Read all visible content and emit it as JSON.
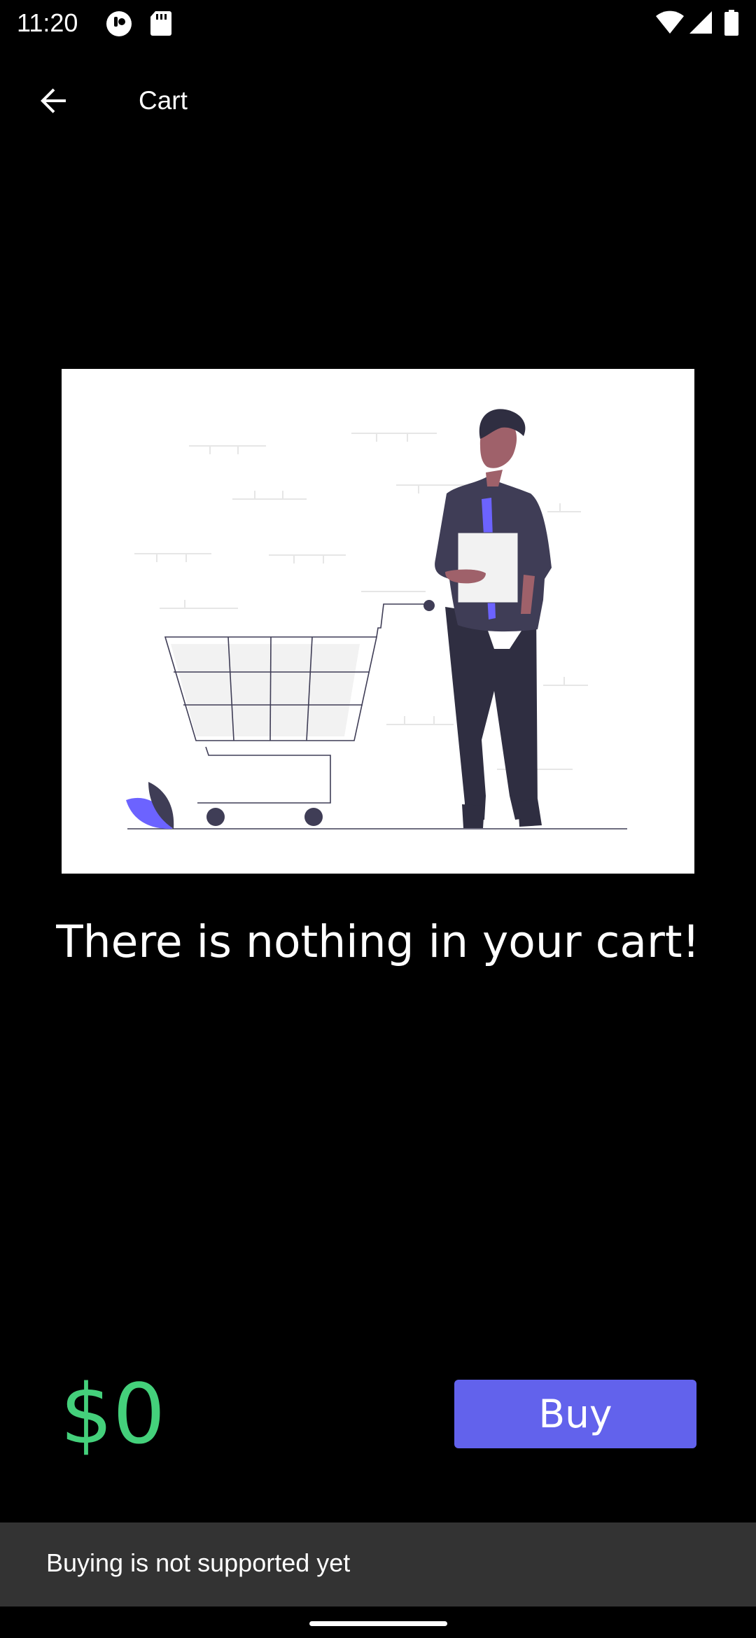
{
  "status_bar": {
    "time": "11:20",
    "icons_left": [
      "mobile-data-icon",
      "sd-card-icon"
    ],
    "icons_right": [
      "wifi-icon",
      "signal-icon",
      "battery-icon"
    ]
  },
  "app_bar": {
    "back_icon": "arrow-back-icon",
    "title": "Cart"
  },
  "main": {
    "empty_message": "There is nothing in your cart!"
  },
  "footer": {
    "total": "$0",
    "buy_label": "Buy"
  },
  "snackbar": {
    "message": "Buying is not supported yet"
  },
  "colors": {
    "background": "#000000",
    "price": "#44d07b",
    "buy_button": "#6262ec",
    "snackbar": "#333333",
    "illustration_accent": "#6c63ff",
    "illustration_dark": "#3f3d56"
  }
}
